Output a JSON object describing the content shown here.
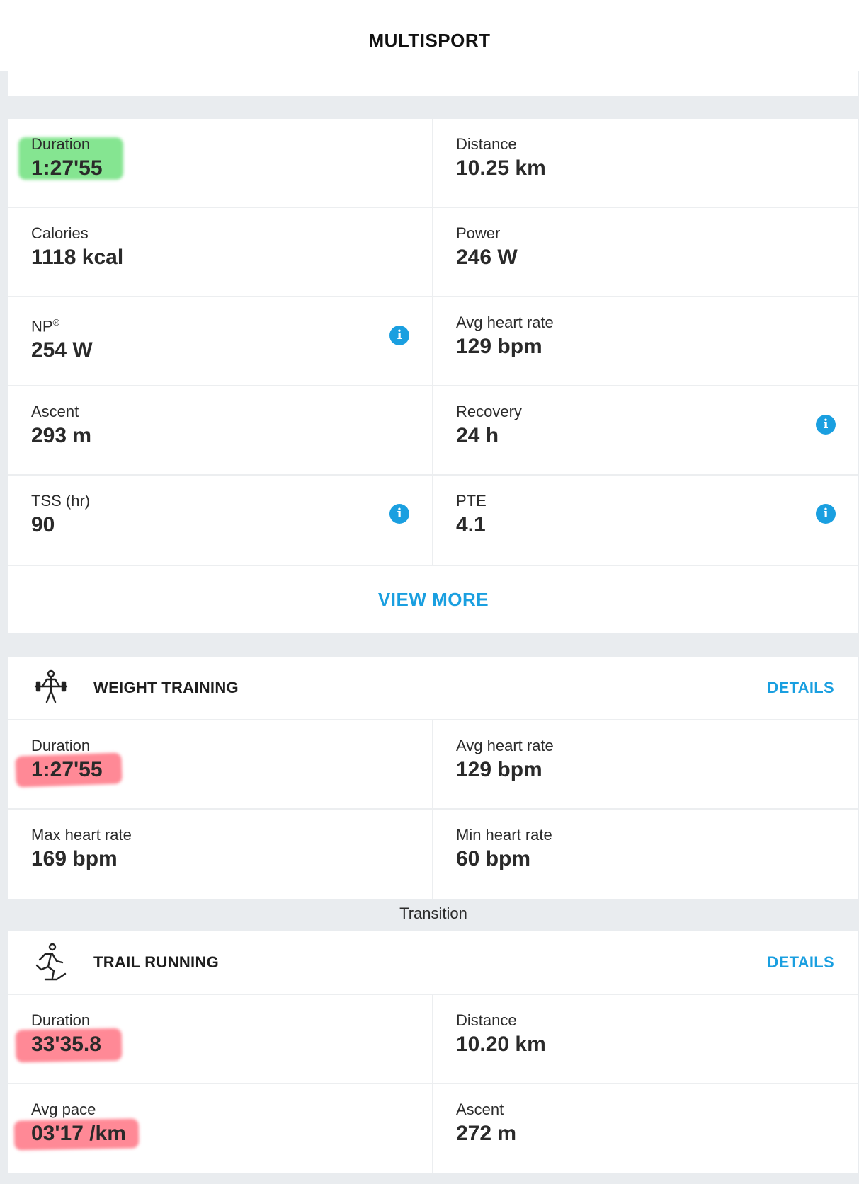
{
  "header": {
    "title": "MULTISPORT"
  },
  "summary": {
    "stats": [
      {
        "label": "Duration",
        "value": "1:27'55"
      },
      {
        "label": "Distance",
        "value": "10.25 km"
      },
      {
        "label": "Calories",
        "value": "1118 kcal"
      },
      {
        "label": "Power",
        "value": "246 W"
      },
      {
        "label": "NP",
        "sup": "®",
        "value": "254 W"
      },
      {
        "label": "Avg heart rate",
        "value": "129 bpm"
      },
      {
        "label": "Ascent",
        "value": "293 m"
      },
      {
        "label": "Recovery",
        "value": "24 h"
      },
      {
        "label": "TSS (hr)",
        "value": "90"
      },
      {
        "label": "PTE",
        "value": "4.1"
      }
    ],
    "view_more_label": "VIEW MORE"
  },
  "weight_training": {
    "name": "WEIGHT TRAINING",
    "details_label": "DETAILS",
    "icon": "weightlifter-icon",
    "stats": [
      {
        "label": "Duration",
        "value": "1:27'55"
      },
      {
        "label": "Avg heart rate",
        "value": "129 bpm"
      },
      {
        "label": "Max heart rate",
        "value": "169 bpm"
      },
      {
        "label": "Min heart rate",
        "value": "60 bpm"
      }
    ]
  },
  "transition_label": "Transition",
  "trail_running": {
    "name": "TRAIL RUNNING",
    "details_label": "DETAILS",
    "icon": "trail-runner-icon",
    "stats": [
      {
        "label": "Duration",
        "value": "33'35.8"
      },
      {
        "label": "Distance",
        "value": "10.20 km"
      },
      {
        "label": "Avg pace",
        "value": "03'17 /km"
      },
      {
        "label": "Ascent",
        "value": "272 m"
      }
    ]
  },
  "colors": {
    "accent": "#1a9fe0",
    "background": "#e9ecef",
    "highlight_green": "#5cdc6c",
    "highlight_red": "#ff5c6e"
  }
}
